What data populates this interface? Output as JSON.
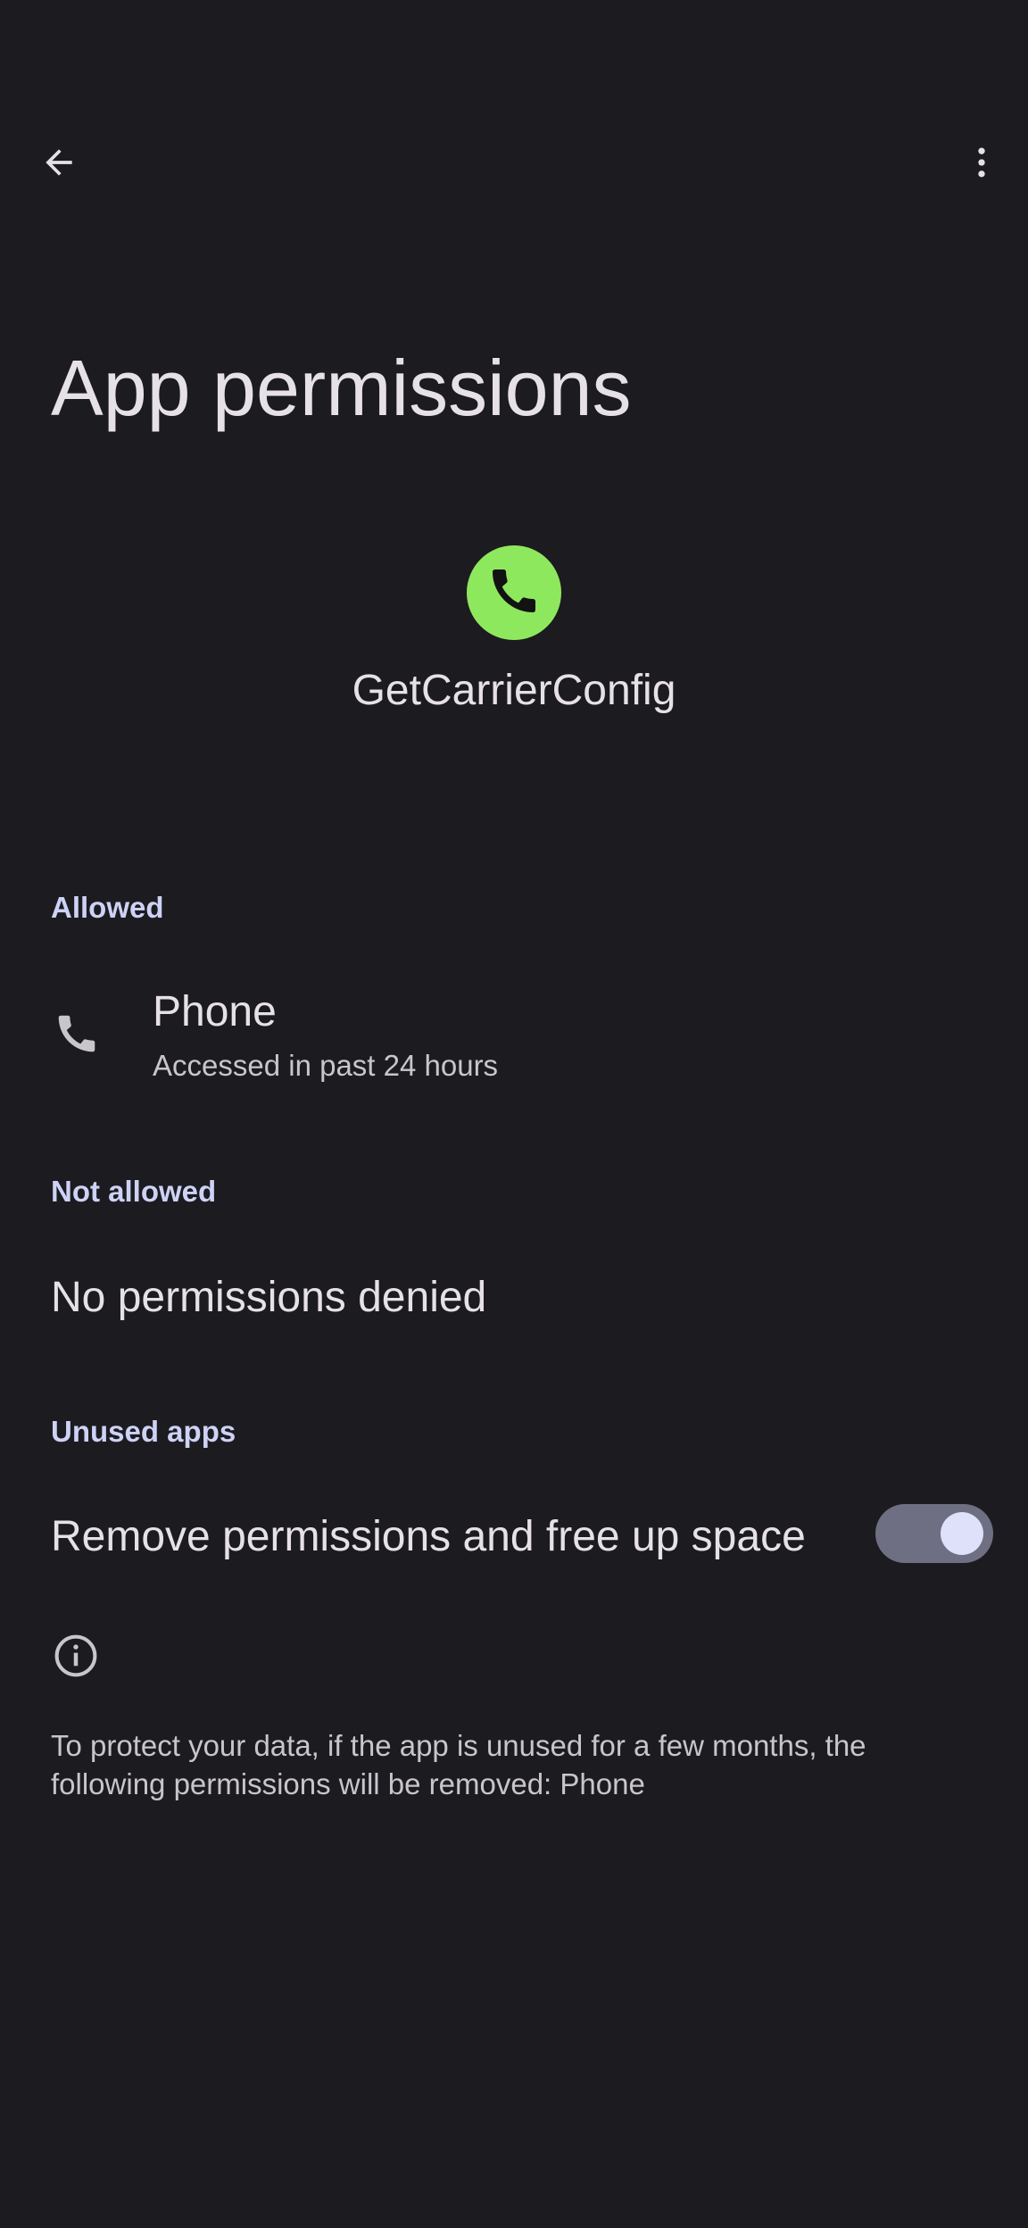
{
  "header": {
    "back_icon": "arrow-back-icon",
    "more_icon": "more-vert-icon",
    "title": "App permissions"
  },
  "app": {
    "icon": "phone-icon",
    "icon_color": "#8ee85e",
    "name": "GetCarrierConfig"
  },
  "allowed": {
    "header": "Allowed",
    "items": [
      {
        "icon": "phone-icon",
        "title": "Phone",
        "subtitle": "Accessed in past 24 hours"
      }
    ]
  },
  "not_allowed": {
    "header": "Not allowed",
    "empty_text": "No permissions denied"
  },
  "unused_apps": {
    "header": "Unused apps",
    "toggle_label": "Remove permissions and free up space",
    "toggle_on": true,
    "info_icon": "info-icon",
    "info_text": "To protect your data, if the app is unused for a few months, the following permissions will be removed: Phone"
  },
  "colors": {
    "background": "#1c1b1f",
    "section_header": "#cdd2f6",
    "toggle_track": "#6e6f82",
    "toggle_knob": "#dfe1fb"
  }
}
